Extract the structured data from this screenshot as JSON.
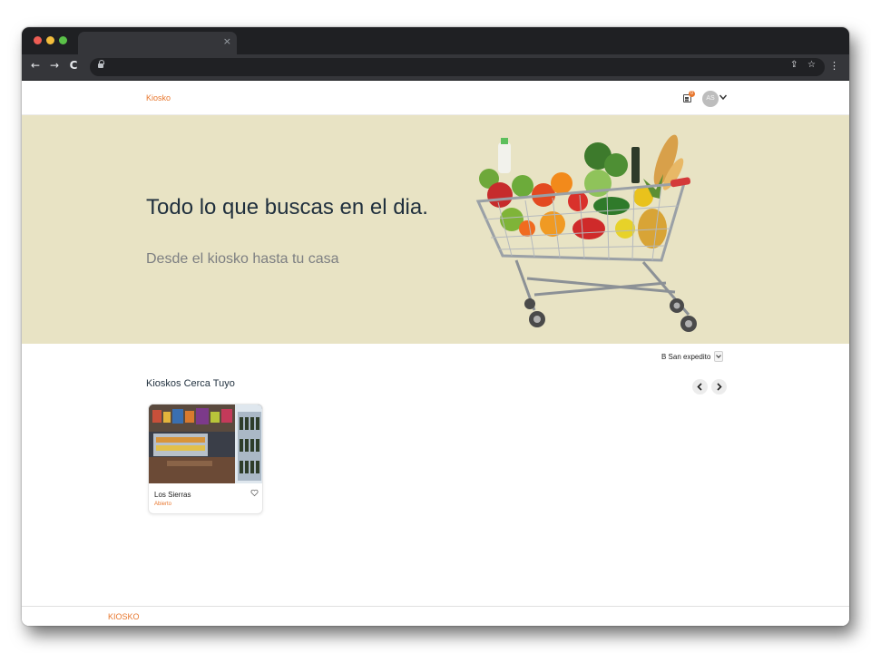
{
  "browser": {
    "tab_close": "×",
    "back": "←",
    "forward": "→",
    "reload": "C",
    "share": "⇪",
    "star": "☆",
    "menu": "⋮"
  },
  "header": {
    "brand": "Kiosko",
    "orders_badge": "0",
    "avatar_initials": "AS"
  },
  "hero": {
    "title": "Todo lo que buscas en el dia.",
    "subtitle": "Desde el kiosko hasta tu casa",
    "background": "#e8e3c4"
  },
  "location": {
    "selected": "B San expedito"
  },
  "nearby": {
    "title": "Kioskos Cerca Tuyo",
    "cards": [
      {
        "name": "Los Sierras",
        "status": "Abierto"
      }
    ]
  },
  "footer": {
    "brand": "KIOSKO"
  },
  "colors": {
    "accent": "#e8772e",
    "heading": "#1f2f3d"
  },
  "icons": [
    "orders-icon",
    "chevron-down-icon",
    "heart-icon",
    "chevron-left-icon",
    "chevron-right-icon",
    "lock-icon"
  ]
}
